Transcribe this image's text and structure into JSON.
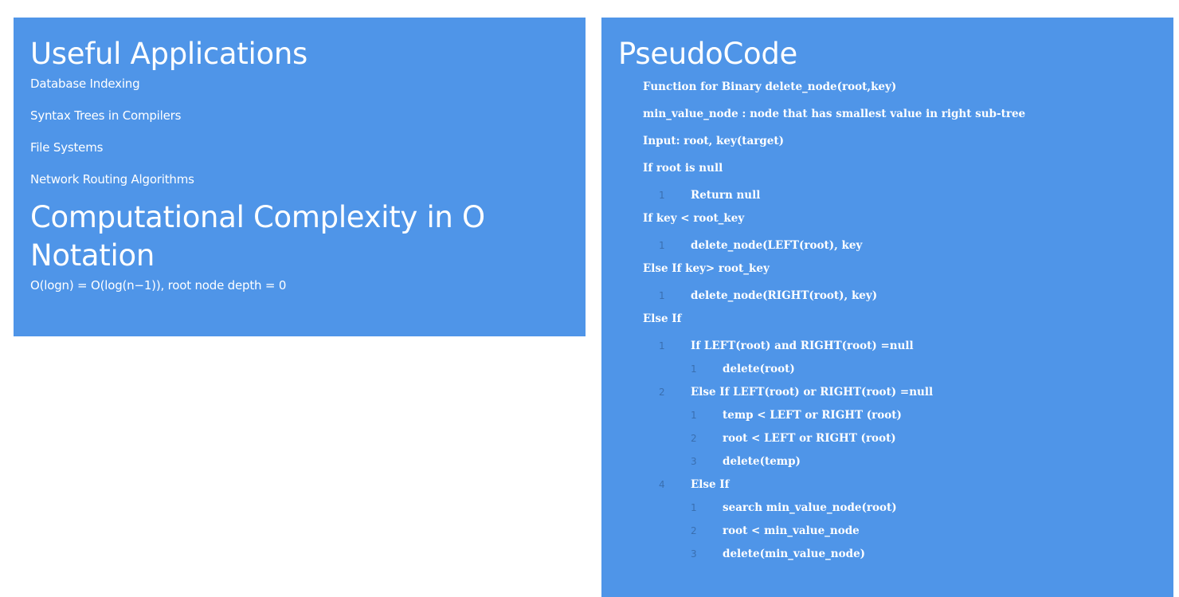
{
  "applications": {
    "heading": "Useful Applications",
    "items": [
      "Database Indexing",
      "Syntax Trees in Compilers",
      "File Systems",
      "Network Routing Algorithms"
    ]
  },
  "complexity": {
    "heading": "Computational Complexity in O Notation",
    "text": "O(logn) = O(log(n−1)), root node depth = 0"
  },
  "pseudocode": {
    "heading": "PseudoCode",
    "lines": [
      {
        "text": "Function for Binary delete_node(root,key)",
        "num": ""
      },
      {
        "text": "min_value_node : node that has smallest value in right sub-tree",
        "num": ""
      },
      {
        "text": "Input: root, key(target)",
        "num": ""
      },
      {
        "text": "If root is null",
        "num": ""
      },
      {
        "text": "Return null",
        "num": "1"
      },
      {
        "text": "If key < root_key",
        "num": ""
      },
      {
        "text": "delete_node(LEFT(root), key",
        "num": "1"
      },
      {
        "text": "Else If key> root_key",
        "num": ""
      },
      {
        "text": "delete_node(RIGHT(root), key)",
        "num": "1"
      },
      {
        "text": "Else If",
        "num": ""
      },
      {
        "text": "If LEFT(root) and RIGHT(root) =null",
        "num": "1"
      },
      {
        "text": "delete(root)",
        "num": "1"
      },
      {
        "text": "Else If LEFT(root) or RIGHT(root) =null",
        "num": "2"
      },
      {
        "text": "temp < LEFT or RIGHT (root)",
        "num": "1"
      },
      {
        "text": "root < LEFT or RIGHT (root)",
        "num": "2"
      },
      {
        "text": "delete(temp)",
        "num": "3"
      },
      {
        "text": "Else If",
        "num": "4"
      },
      {
        "text": "search min_value_node(root)",
        "num": "1"
      },
      {
        "text": "root < min_value_node",
        "num": "2"
      },
      {
        "text": "delete(min_value_node)",
        "num": "3"
      }
    ]
  },
  "colors": {
    "panel_bg": "#4f95e8",
    "page_bg": "#ffffff",
    "text": "#ffffff",
    "line_number": "#3a6fb0"
  }
}
